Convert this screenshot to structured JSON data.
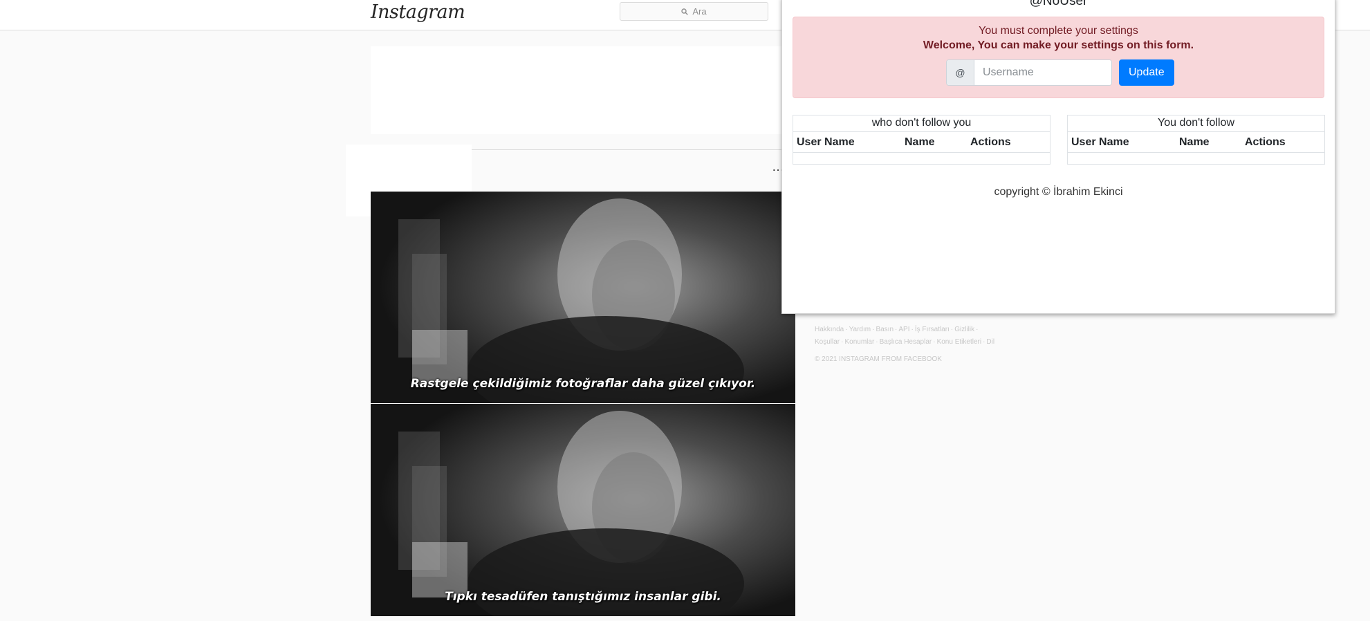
{
  "instagram": {
    "logo": "Instagram",
    "search": {
      "placeholder": "Ara",
      "icon": "search-icon"
    },
    "posts": [
      {
        "caption": "Rastgele çekildiğimiz fotoğraflar daha güzel çıkıyor."
      },
      {
        "caption": "Tıpkı tesadüfen tanıştığımız insanlar gibi."
      }
    ],
    "more_icon": "…",
    "footer": {
      "links": [
        "Hakkında",
        "Yardım",
        "Basın",
        "API",
        "İş Fırsatları",
        "Gizlilik",
        "Koşullar",
        "Konumlar",
        "Başlıca Hesaplar",
        "Konu Etiketleri",
        "Dil"
      ],
      "copyright": "© 2021 INSTAGRAM FROM FACEBOOK"
    }
  },
  "extension": {
    "handle": "@NoUser",
    "alert": {
      "line1": "You must complete your settings",
      "line2": "Welcome, You can make your settings on this form."
    },
    "form": {
      "prefix": "@",
      "username_placeholder": "Username",
      "username_value": "",
      "update_label": "Update"
    },
    "tables": [
      {
        "caption": "who don't follow you",
        "headers": [
          "User Name",
          "Name",
          "Actions"
        ],
        "rows": []
      },
      {
        "caption": "You don't follow",
        "headers": [
          "User Name",
          "Name",
          "Actions"
        ],
        "rows": []
      }
    ],
    "copyright": "copyright © İbrahim Ekinci",
    "colors": {
      "alert_bg": "#f8d7da",
      "alert_text": "#721c24",
      "primary": "#007bff"
    }
  }
}
